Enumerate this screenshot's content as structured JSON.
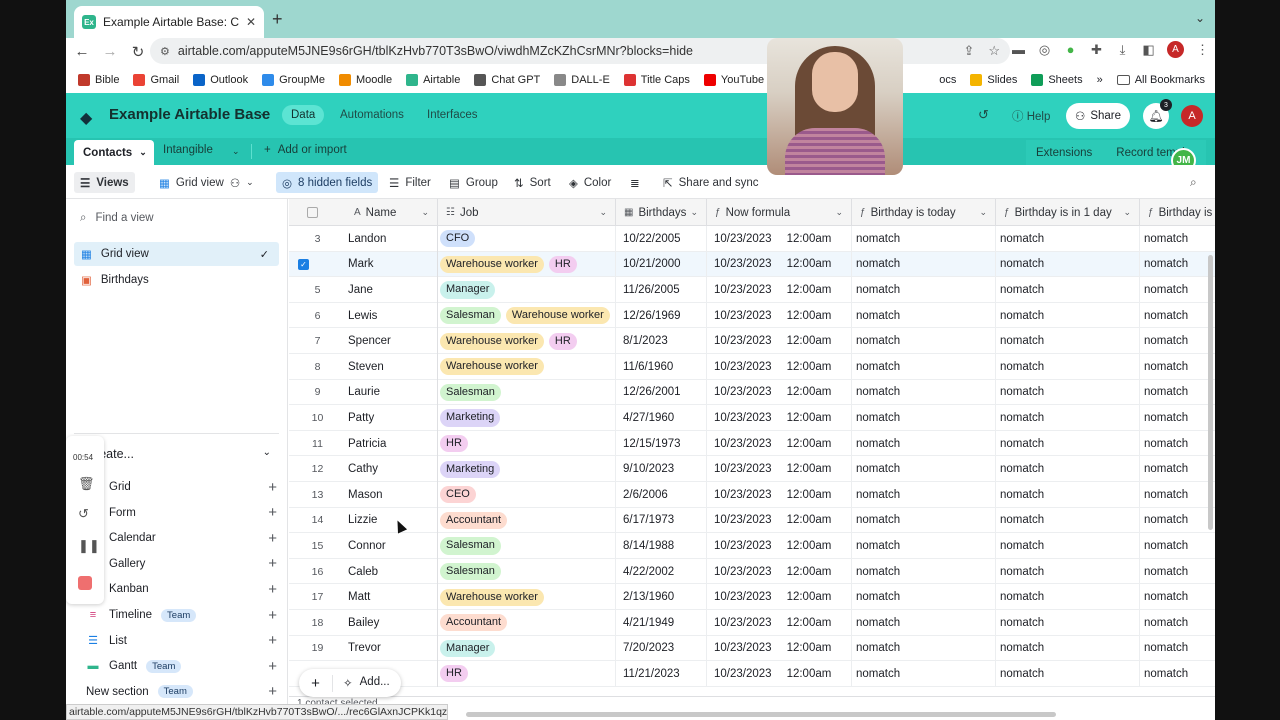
{
  "browser": {
    "tab_title": "Example Airtable Base: Contac",
    "url": "airtable.com/apputeM5JNE9s6rGH/tblKzHvb770T3sBwO/viwdhMZcKZhCsrMNr?blocks=hide",
    "bookmarks": [
      {
        "label": "Bible",
        "color": "#c0392b"
      },
      {
        "label": "Gmail",
        "color": "#ea4335"
      },
      {
        "label": "Outlook",
        "color": "#0a64c8"
      },
      {
        "label": "GroupMe",
        "color": "#2e8bea"
      },
      {
        "label": "Moodle",
        "color": "#f08c00"
      },
      {
        "label": "Airtable",
        "color": "#2fb58c"
      },
      {
        "label": "Chat GPT",
        "color": "#555555"
      },
      {
        "label": "DALL-E",
        "color": "#888888"
      },
      {
        "label": "Title Caps",
        "color": "#d33"
      },
      {
        "label": "YouTube",
        "color": "#e00"
      },
      {
        "label": "",
        "color": "#1a8bd6"
      }
    ],
    "bookmarks_right": [
      "ocs",
      "Slides",
      "Sheets",
      "»",
      "All Bookmarks"
    ],
    "profile_initial": "A",
    "status_url": "airtable.com/apputeM5JNE9s6rGH/tblKzHvb770T3sBwO/.../rec6GlAxnJCPKk1qz..."
  },
  "app": {
    "base_name": "Example Airtable Base",
    "nav": [
      "Data",
      "Automations",
      "Interfaces"
    ],
    "help": "Help",
    "share": "Share",
    "notif_count": "3",
    "user_initial": "A",
    "table_tabs": {
      "active": "Contacts",
      "other": "Intangible",
      "add": "Add or import"
    },
    "extensions": "Extensions",
    "record_templates": "Record templ",
    "jm_badge": "JM"
  },
  "viewbar": {
    "views": "Views",
    "grid_view": "Grid view",
    "hidden_fields": "8 hidden fields",
    "filter": "Filter",
    "group": "Group",
    "sort": "Sort",
    "color": "Color",
    "share_sync": "Share and sync"
  },
  "sidebar": {
    "find_placeholder": "Find a view",
    "views": [
      {
        "label": "Grid view"
      },
      {
        "label": "Birthdays"
      }
    ],
    "create_title": "Create...",
    "create_items": [
      {
        "label": "Grid",
        "team": ""
      },
      {
        "label": "Form",
        "team": ""
      },
      {
        "label": "Calendar",
        "team": ""
      },
      {
        "label": "Gallery",
        "team": ""
      },
      {
        "label": "Kanban",
        "team": ""
      },
      {
        "label": "Timeline",
        "team": "Team"
      },
      {
        "label": "List",
        "team": ""
      },
      {
        "label": "Gantt",
        "team": "Team"
      },
      {
        "label": "New section",
        "team": "Team"
      }
    ]
  },
  "recorder": {
    "time": "00:54"
  },
  "grid": {
    "columns": [
      "Name",
      "Job",
      "Birthdays",
      "Now formula",
      "Birthday is today",
      "Birthday is in 1 day",
      "Birthday is i"
    ],
    "colors": {
      "CFO": "#cfe0fb",
      "HR": "#f3cdf0",
      "Warehouse worker": "#fbe7b0",
      "Manager": "#c9f1ec",
      "Salesman": "#d1f4cf",
      "Marketing": "#dcd4f7",
      "CEO": "#fcd4d4",
      "Accountant": "#fddccf"
    },
    "rows": [
      {
        "n": "3",
        "name": "Landon",
        "jobs": [
          "CFO"
        ],
        "bday": "10/22/2005",
        "date": "10/23/2023",
        "time": "12:00am",
        "a": "nomatch",
        "b": "nomatch",
        "c": "nomatch"
      },
      {
        "n": "",
        "name": "Mark",
        "jobs": [
          "Warehouse worker",
          "HR"
        ],
        "bday": "10/21/2000",
        "date": "10/23/2023",
        "time": "12:00am",
        "a": "nomatch",
        "b": "nomatch",
        "c": "nomatch",
        "selected": true
      },
      {
        "n": "5",
        "name": "Jane",
        "jobs": [
          "Manager"
        ],
        "bday": "11/26/2005",
        "date": "10/23/2023",
        "time": "12:00am",
        "a": "nomatch",
        "b": "nomatch",
        "c": "nomatch"
      },
      {
        "n": "6",
        "name": "Lewis",
        "jobs": [
          "Salesman",
          "Warehouse worker"
        ],
        "bday": "12/26/1969",
        "date": "10/23/2023",
        "time": "12:00am",
        "a": "nomatch",
        "b": "nomatch",
        "c": "nomatch"
      },
      {
        "n": "7",
        "name": "Spencer",
        "jobs": [
          "Warehouse worker",
          "HR"
        ],
        "bday": "8/1/2023",
        "date": "10/23/2023",
        "time": "12:00am",
        "a": "nomatch",
        "b": "nomatch",
        "c": "nomatch"
      },
      {
        "n": "8",
        "name": "Steven",
        "jobs": [
          "Warehouse worker"
        ],
        "bday": "11/6/1960",
        "date": "10/23/2023",
        "time": "12:00am",
        "a": "nomatch",
        "b": "nomatch",
        "c": "nomatch"
      },
      {
        "n": "9",
        "name": "Laurie",
        "jobs": [
          "Salesman"
        ],
        "bday": "12/26/2001",
        "date": "10/23/2023",
        "time": "12:00am",
        "a": "nomatch",
        "b": "nomatch",
        "c": "nomatch"
      },
      {
        "n": "10",
        "name": "Patty",
        "jobs": [
          "Marketing"
        ],
        "bday": "4/27/1960",
        "date": "10/23/2023",
        "time": "12:00am",
        "a": "nomatch",
        "b": "nomatch",
        "c": "nomatch"
      },
      {
        "n": "11",
        "name": "Patricia",
        "jobs": [
          "HR"
        ],
        "bday": "12/15/1973",
        "date": "10/23/2023",
        "time": "12:00am",
        "a": "nomatch",
        "b": "nomatch",
        "c": "nomatch"
      },
      {
        "n": "12",
        "name": "Cathy",
        "jobs": [
          "Marketing"
        ],
        "bday": "9/10/2023",
        "date": "10/23/2023",
        "time": "12:00am",
        "a": "nomatch",
        "b": "nomatch",
        "c": "nomatch"
      },
      {
        "n": "13",
        "name": "Mason",
        "jobs": [
          "CEO"
        ],
        "bday": "2/6/2006",
        "date": "10/23/2023",
        "time": "12:00am",
        "a": "nomatch",
        "b": "nomatch",
        "c": "nomatch"
      },
      {
        "n": "14",
        "name": "Lizzie",
        "jobs": [
          "Accountant"
        ],
        "bday": "6/17/1973",
        "date": "10/23/2023",
        "time": "12:00am",
        "a": "nomatch",
        "b": "nomatch",
        "c": "nomatch"
      },
      {
        "n": "15",
        "name": "Connor",
        "jobs": [
          "Salesman"
        ],
        "bday": "8/14/1988",
        "date": "10/23/2023",
        "time": "12:00am",
        "a": "nomatch",
        "b": "nomatch",
        "c": "nomatch"
      },
      {
        "n": "16",
        "name": "Caleb",
        "jobs": [
          "Salesman"
        ],
        "bday": "4/22/2002",
        "date": "10/23/2023",
        "time": "12:00am",
        "a": "nomatch",
        "b": "nomatch",
        "c": "nomatch"
      },
      {
        "n": "17",
        "name": "Matt",
        "jobs": [
          "Warehouse worker"
        ],
        "bday": "2/13/1960",
        "date": "10/23/2023",
        "time": "12:00am",
        "a": "nomatch",
        "b": "nomatch",
        "c": "nomatch"
      },
      {
        "n": "18",
        "name": "Bailey",
        "jobs": [
          "Accountant"
        ],
        "bday": "4/21/1949",
        "date": "10/23/2023",
        "time": "12:00am",
        "a": "nomatch",
        "b": "nomatch",
        "c": "nomatch"
      },
      {
        "n": "19",
        "name": "Trevor",
        "jobs": [
          "Manager"
        ],
        "bday": "7/20/2023",
        "date": "10/23/2023",
        "time": "12:00am",
        "a": "nomatch",
        "b": "nomatch",
        "c": "nomatch"
      },
      {
        "n": "",
        "name": "",
        "jobs": [
          "HR"
        ],
        "bday": "11/21/2023",
        "date": "10/23/2023",
        "time": "12:00am",
        "a": "nomatch",
        "b": "nomatch",
        "c": "nomatch"
      }
    ],
    "add_label": "Add...",
    "footer_count": "1 contact selected"
  }
}
